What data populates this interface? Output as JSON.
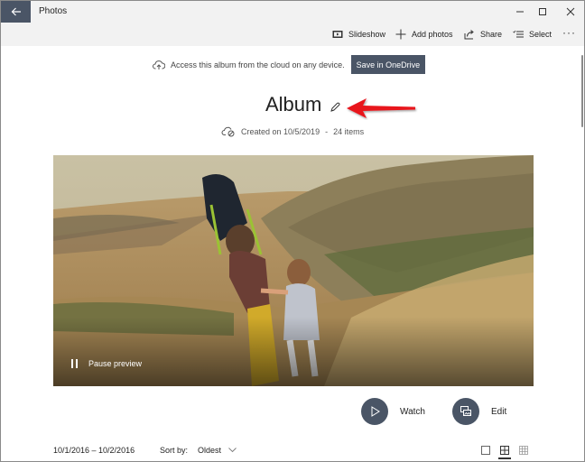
{
  "window": {
    "app_title": "Photos",
    "back_icon": "arrow-left-icon",
    "controls": [
      "minimize-icon",
      "maximize-icon",
      "close-icon"
    ]
  },
  "toolbar": {
    "slideshow_label": "Slideshow",
    "add_photos_label": "Add photos",
    "share_label": "Share",
    "select_label": "Select",
    "more_label": "···"
  },
  "cloud_banner": {
    "text": "Access this album from the cloud on any device.",
    "button_label": "Save in OneDrive",
    "icon": "cloud-upload-icon"
  },
  "album": {
    "title": "Album",
    "edit_icon": "pencil-icon",
    "created_text": "Created on 10/5/2019",
    "separator": "-",
    "item_count": "24 items",
    "annotation": "red-arrow pointing at rename pencil"
  },
  "preview": {
    "pause_label": "Pause preview",
    "description": "Man with backpack holding hands with a toddler walking on a grassy hillside"
  },
  "actions": {
    "watch_label": "Watch",
    "edit_label": "Edit"
  },
  "footer": {
    "date_range": "10/1/2016 – 10/2/2016",
    "sort_label": "Sort by:",
    "sort_value": "Oldest",
    "view_modes": [
      "single-view",
      "medium-grid",
      "small-grid"
    ],
    "selected_view": "medium-grid"
  },
  "colors": {
    "accent_dark": "#4a5566",
    "chrome_bg": "#f2f2f2",
    "annotation_red": "#e8141b"
  }
}
